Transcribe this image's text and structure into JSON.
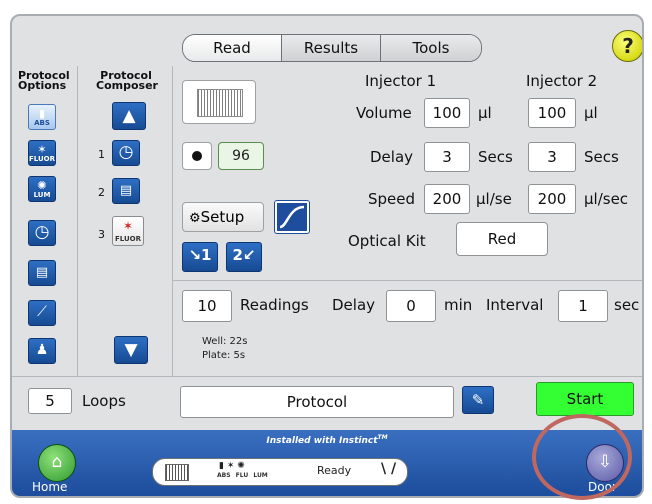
{
  "tabs": [
    {
      "label": "Read",
      "active": true
    },
    {
      "label": "Results",
      "active": false
    },
    {
      "label": "Tools",
      "active": false
    }
  ],
  "help_label": "?",
  "left_panel": {
    "protocol_options_title": "Protocol Options",
    "protocol_composer_title": "Protocol Composer",
    "option_buttons": [
      {
        "icon": "absorbance-icon",
        "label": "ABS"
      },
      {
        "icon": "fluorescence-icon",
        "label": "FLUOR"
      },
      {
        "icon": "luminescence-icon",
        "label": "LUM"
      },
      {
        "icon": "kinetic-clock-icon",
        "label": ""
      },
      {
        "icon": "plate-shake-icon",
        "label": ""
      },
      {
        "icon": "injector-icon",
        "label": ""
      },
      {
        "icon": "user-icon",
        "label": ""
      }
    ],
    "composer_steps": [
      {
        "number": "1",
        "icon": "kinetic-clock-icon",
        "label": ""
      },
      {
        "number": "2",
        "icon": "plate-shake-icon",
        "label": ""
      },
      {
        "number": "3",
        "icon": "fluorescence-icon",
        "label": "FLUOR"
      }
    ]
  },
  "plate": {
    "well_count": "96"
  },
  "setup_label": "Setup",
  "injectors": {
    "injector1_title": "Injector 1",
    "injector2_title": "Injector 2",
    "volume_label": "Volume",
    "volume1": "100",
    "volume1_unit": "µl",
    "volume2": "100",
    "volume2_unit": "µl",
    "delay_label": "Delay",
    "delay1": "3",
    "delay1_unit": "Secs",
    "delay2": "3",
    "delay2_unit": "Secs",
    "speed_label": "Speed",
    "speed1": "200",
    "speed1_unit": "µl/se",
    "speed2": "200",
    "speed2_unit": "µl/sec",
    "optical_kit_label": "Optical Kit",
    "optical_kit_value": "Red"
  },
  "kinetic": {
    "readings": "10",
    "readings_label": "Readings",
    "delay_label": "Delay",
    "delay": "0",
    "delay_unit": "min",
    "interval_label": "Interval",
    "interval": "1",
    "interval_unit": "sec"
  },
  "timing": {
    "well": "Well: 22s",
    "plate": "Plate: 5s"
  },
  "loops": {
    "value": "5",
    "label": "Loops"
  },
  "protocol_name": "Protocol",
  "start_label": "Start",
  "bottom_bar": {
    "installed_text": "Installed with Instinct",
    "tm": "TM",
    "home_label": "Home",
    "door_label": "Door",
    "status": "Ready",
    "modes": [
      "ABS",
      "FLU",
      "LUM"
    ]
  },
  "colors": {
    "start_green": "#33ff33",
    "bar_blue": "#2a5db0",
    "highlight_circle": "#c0675f"
  }
}
